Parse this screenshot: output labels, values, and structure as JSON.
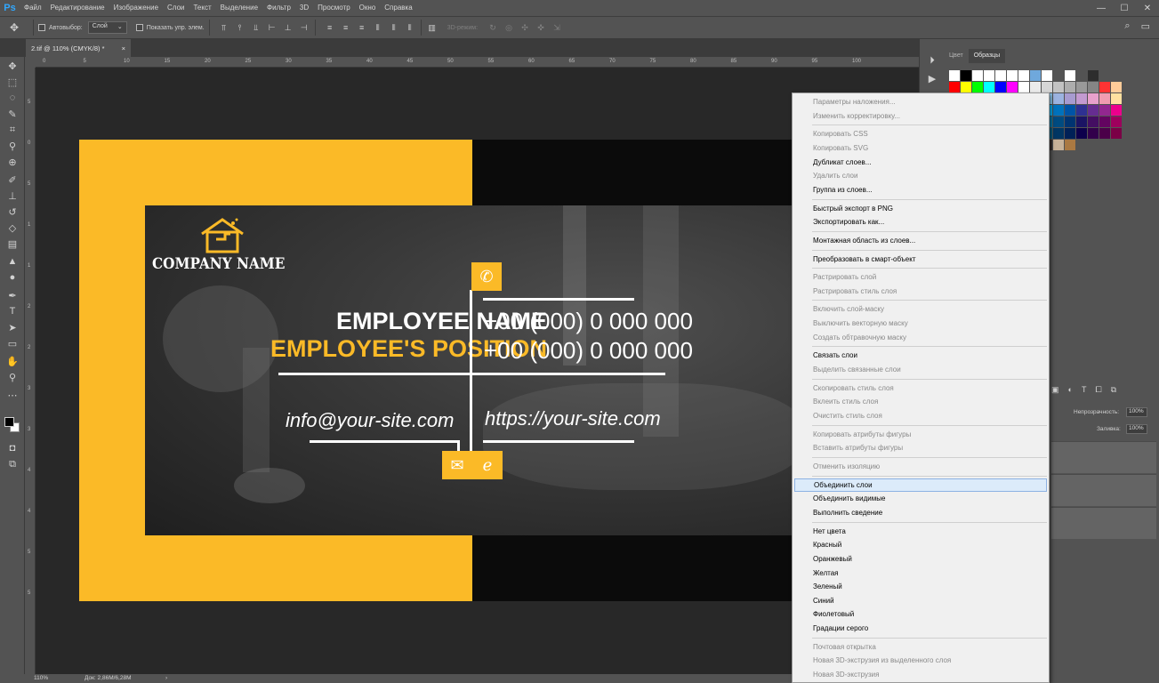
{
  "app": {
    "logo": "Ps"
  },
  "menubar": {
    "items": [
      "Файл",
      "Редактирование",
      "Изображение",
      "Слои",
      "Текст",
      "Выделение",
      "Фильтр",
      "3D",
      "Просмотр",
      "Окно",
      "Справка"
    ],
    "window_controls": [
      "—",
      "☐",
      "✕"
    ]
  },
  "options": {
    "auto_select_label": "Автовыбор:",
    "auto_select_value": "Слой",
    "show_controls_label": "Показать упр. элем.",
    "mode3d_label": "3D-режим:"
  },
  "document_tab": {
    "title": "2.tif @ 110% (CMYK/8) *",
    "close": "×"
  },
  "status": {
    "zoom": "110%",
    "doc_size": "Док: 2,86M/6,28M",
    "arrow": "›"
  },
  "rulers": {
    "h_ticks": [
      "0",
      "5",
      "10",
      "15",
      "20",
      "25",
      "30",
      "35",
      "40",
      "45",
      "50",
      "55",
      "60",
      "65",
      "70",
      "75",
      "80",
      "85",
      "90",
      "95",
      "100"
    ],
    "v_ticks": [
      "5",
      "0",
      "5",
      "1",
      "1",
      "2",
      "2",
      "3",
      "3",
      "4",
      "4",
      "5",
      "5"
    ]
  },
  "card": {
    "company": "COMPANY NAME",
    "employee_name": "EMPLOYEE NAME",
    "employee_position": "EMPLOYEE'S POSITION",
    "phone1": "+00 (000) 0 000 000",
    "phone2": "+00 (000) 0 000 000",
    "email": "info@your-site.com",
    "website": "https://your-site.com",
    "accent_color": "#fbba27"
  },
  "panels": {
    "swatch_tabs": [
      "Цвет",
      "Образцы"
    ],
    "opacity_label": "Непрозрачность:",
    "opacity_value": "100%",
    "fill_label": "Заливка:",
    "fill_value": "100%"
  },
  "context_menu": {
    "items": [
      {
        "label": "Параметры наложения...",
        "disabled": true
      },
      {
        "label": "Изменить корректировку...",
        "disabled": true
      },
      {
        "sep": true
      },
      {
        "label": "Копировать CSS",
        "disabled": true
      },
      {
        "label": "Копировать SVG",
        "disabled": true
      },
      {
        "label": "Дубликат слоев...",
        "disabled": false
      },
      {
        "label": "Удалить слои",
        "disabled": true
      },
      {
        "label": "Группа из слоев...",
        "disabled": false
      },
      {
        "sep": true
      },
      {
        "label": "Быстрый экспорт в PNG",
        "disabled": false
      },
      {
        "label": "Экспортировать как...",
        "disabled": false
      },
      {
        "sep": true
      },
      {
        "label": "Монтажная область из слоев...",
        "disabled": false
      },
      {
        "sep": true
      },
      {
        "label": "Преобразовать в смарт-объект",
        "disabled": false
      },
      {
        "sep": true
      },
      {
        "label": "Растрировать слой",
        "disabled": true
      },
      {
        "label": "Растрировать стиль слоя",
        "disabled": true
      },
      {
        "sep": true
      },
      {
        "label": "Включить слой-маску",
        "disabled": true
      },
      {
        "label": "Выключить векторную маску",
        "disabled": true
      },
      {
        "label": "Создать обтравочную маску",
        "disabled": true
      },
      {
        "sep": true
      },
      {
        "label": "Связать слои",
        "disabled": false
      },
      {
        "label": "Выделить связанные слои",
        "disabled": true
      },
      {
        "sep": true
      },
      {
        "label": "Скопировать стиль слоя",
        "disabled": true
      },
      {
        "label": "Вклеить стиль слоя",
        "disabled": true
      },
      {
        "label": "Очистить стиль слоя",
        "disabled": true
      },
      {
        "sep": true
      },
      {
        "label": "Копировать атрибуты фигуры",
        "disabled": true
      },
      {
        "label": "Вставить атрибуты фигуры",
        "disabled": true
      },
      {
        "sep": true
      },
      {
        "label": "Отменить изоляцию",
        "disabled": true
      },
      {
        "sep": true
      },
      {
        "label": "Объединить слои",
        "disabled": false,
        "highlight": true
      },
      {
        "label": "Объединить видимые",
        "disabled": false
      },
      {
        "label": "Выполнить сведение",
        "disabled": false
      },
      {
        "sep": true
      },
      {
        "label": "Нет цвета",
        "disabled": false
      },
      {
        "label": "Красный",
        "disabled": false
      },
      {
        "label": "Оранжевый",
        "disabled": false
      },
      {
        "label": "Желтая",
        "disabled": false
      },
      {
        "label": "Зеленый",
        "disabled": false
      },
      {
        "label": "Синий",
        "disabled": false
      },
      {
        "label": "Фиолетовый",
        "disabled": false
      },
      {
        "label": "Градации серого",
        "disabled": false
      },
      {
        "sep": true
      },
      {
        "label": "Почтовая открытка",
        "disabled": true
      },
      {
        "label": "Новая 3D-экструзия из выделенного слоя",
        "disabled": true
      },
      {
        "label": "Новая 3D-экструзия",
        "disabled": true
      }
    ]
  },
  "swatch_colors": [
    "#ffffff",
    "#000000",
    "#ffffff",
    "#ffffff",
    "#ffffff",
    "#ffffff",
    "#ffffff",
    "#6fa8dc",
    "#ffffff",
    "#535353",
    "#ffffff",
    "#535353",
    "#2d2d2d",
    "#535353",
    "#535353",
    "#ff0000",
    "#ffff00",
    "#00ff00",
    "#00ffff",
    "#0000ff",
    "#ff00ff",
    "#ffffff",
    "#ebebeb",
    "#d6d6d6",
    "#c2c2c2",
    "#adadad",
    "#999999",
    "#858585",
    "#ff3333",
    "#ffcc99",
    "#f49b9b",
    "#f8b08a",
    "#fbd08b",
    "#fff799",
    "#c9e39f",
    "#9fd39b",
    "#8ed1b6",
    "#8fd8d6",
    "#8fc9ef",
    "#9cb3e0",
    "#a79bd0",
    "#c39ad0",
    "#e8a0cc",
    "#f19cb0",
    "#ffe0a0",
    "#ed1c24",
    "#f26522",
    "#f7941d",
    "#fff200",
    "#8dc63f",
    "#39b54a",
    "#00a651",
    "#00a99d",
    "#00aeef",
    "#0072bc",
    "#0054a6",
    "#2e3192",
    "#662d91",
    "#92278f",
    "#ec008c",
    "#9e0b0f",
    "#a0410d",
    "#a36209",
    "#aba000",
    "#598527",
    "#1a7b30",
    "#007236",
    "#00746b",
    "#0076a3",
    "#004b80",
    "#003471",
    "#1b1464",
    "#440e62",
    "#630460",
    "#9e005d",
    "#790000",
    "#7b2e00",
    "#7d4900",
    "#827b00",
    "#406618",
    "#005e20",
    "#005826",
    "#005952",
    "#005b7f",
    "#003663",
    "#002157",
    "#0d004c",
    "#32004b",
    "#4b0049",
    "#7b0046",
    "#c69c6d",
    "#a67c52",
    "#8c6239",
    "#754c24",
    "#603913",
    "#998675",
    "#736357",
    "#534741",
    "#362f2d",
    "#c7b299",
    "#aa7942"
  ]
}
